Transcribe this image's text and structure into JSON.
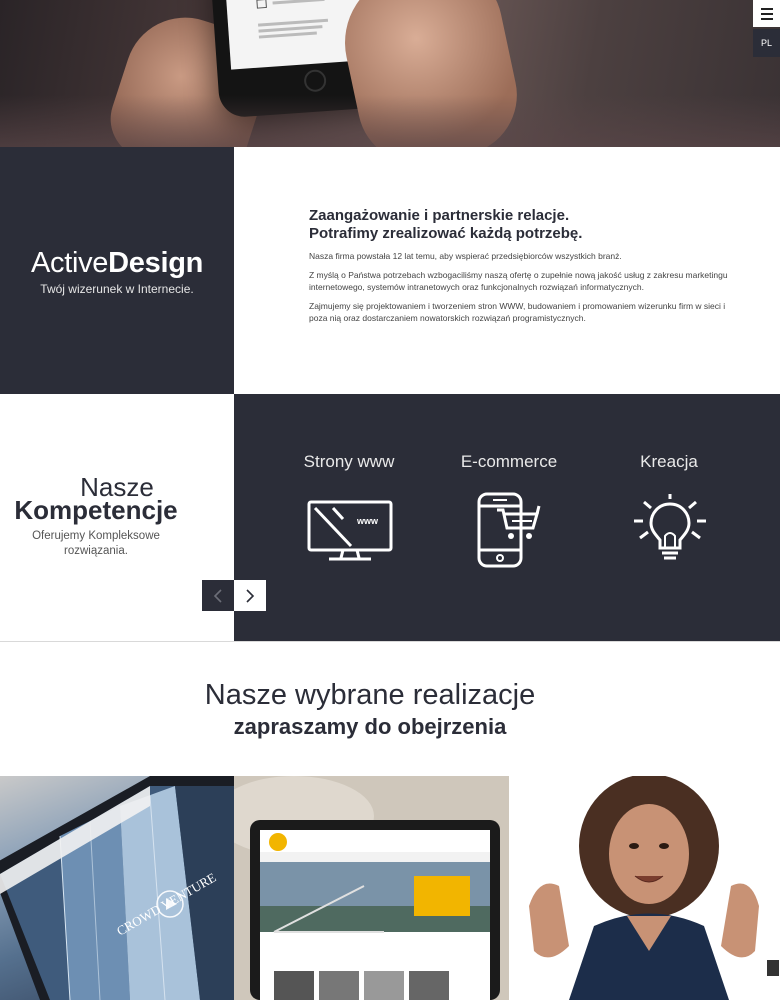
{
  "nav": {
    "language": "PL"
  },
  "brand": {
    "name_light": "Active",
    "name_bold": "Design",
    "tagline": "Twój wizerunek w Internecie."
  },
  "about": {
    "heading_line1": "Zaangażowanie i partnerskie relacje.",
    "heading_line2": "Potrafimy zrealizować każdą potrzebę.",
    "paragraphs": [
      "Nasza firma powstała 12 lat temu, aby wspierać przedsiębiorców wszystkich branż.",
      "Z myślą o Państwa potrzebach wzbogaciliśmy naszą ofertę o zupełnie nową jakość usług z zakresu marketingu internetowego, systemów intranetowych oraz funkcjonalnych rozwiązań informatycznych.",
      "Zajmujemy się projektowaniem i tworzeniem stron WWW, budowaniem i promowaniem wizerunku firm w sieci i poza nią oraz dostarczaniem nowatorskich rozwiązań programistycznych."
    ]
  },
  "competences": {
    "title_light": "Nasze",
    "title_bold": "Kompetencje",
    "subtitle": "Oferujemy Kompleksowe rozwiązania."
  },
  "services": [
    {
      "label": "Strony www",
      "icon": "monitor-www-icon",
      "icon_text": "www"
    },
    {
      "label": "E-commerce",
      "icon": "phone-cart-icon"
    },
    {
      "label": "Kreacja",
      "icon": "lightbulb-icon"
    }
  ],
  "realizations": {
    "title_light": "Nasze wybrane realizacje",
    "title_bold": "zapraszamy do obejrzenia"
  },
  "portfolio_tiles": [
    {
      "name": "crowd-venture-tablet",
      "overlay_text": "CROWD VENTURE"
    },
    {
      "name": "laptop-website"
    },
    {
      "name": "portrait-man"
    }
  ],
  "colors": {
    "dark": "#2b2d38",
    "light": "#ffffff",
    "accent_yellow": "#f2b500"
  }
}
